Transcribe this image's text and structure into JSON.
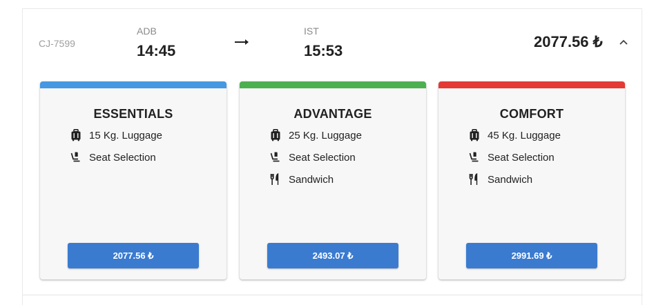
{
  "flight": {
    "code": "CJ-7599",
    "origin": "ADB",
    "departure_time": "14:45",
    "destination": "IST",
    "arrival_time": "15:53",
    "price": "2077.56 ₺",
    "expand_icon": "chevron-up-icon",
    "arrow_icon": "arrow-right-icon"
  },
  "fares": [
    {
      "name": "ESSENTIALS",
      "accent_color": "#4598e1",
      "features": [
        {
          "icon": "luggage-icon",
          "label": "15 Kg. Luggage"
        },
        {
          "icon": "seat-icon",
          "label": "Seat Selection"
        }
      ],
      "button_label": "2077.56 ₺"
    },
    {
      "name": "ADVANTAGE",
      "accent_color": "#4caf50",
      "features": [
        {
          "icon": "luggage-icon",
          "label": "25 Kg. Luggage"
        },
        {
          "icon": "seat-icon",
          "label": "Seat Selection"
        },
        {
          "icon": "meal-icon",
          "label": "Sandwich"
        }
      ],
      "button_label": "2493.07 ₺"
    },
    {
      "name": "COMFORT",
      "accent_color": "#e53935",
      "features": [
        {
          "icon": "luggage-icon",
          "label": "45 Kg. Luggage"
        },
        {
          "icon": "seat-icon",
          "label": "Seat Selection"
        },
        {
          "icon": "meal-icon",
          "label": "Sandwich"
        }
      ],
      "button_label": "2991.69 ₺"
    }
  ],
  "colors": {
    "button": "#3a7bd0",
    "card_background": "#f7f7f7"
  }
}
